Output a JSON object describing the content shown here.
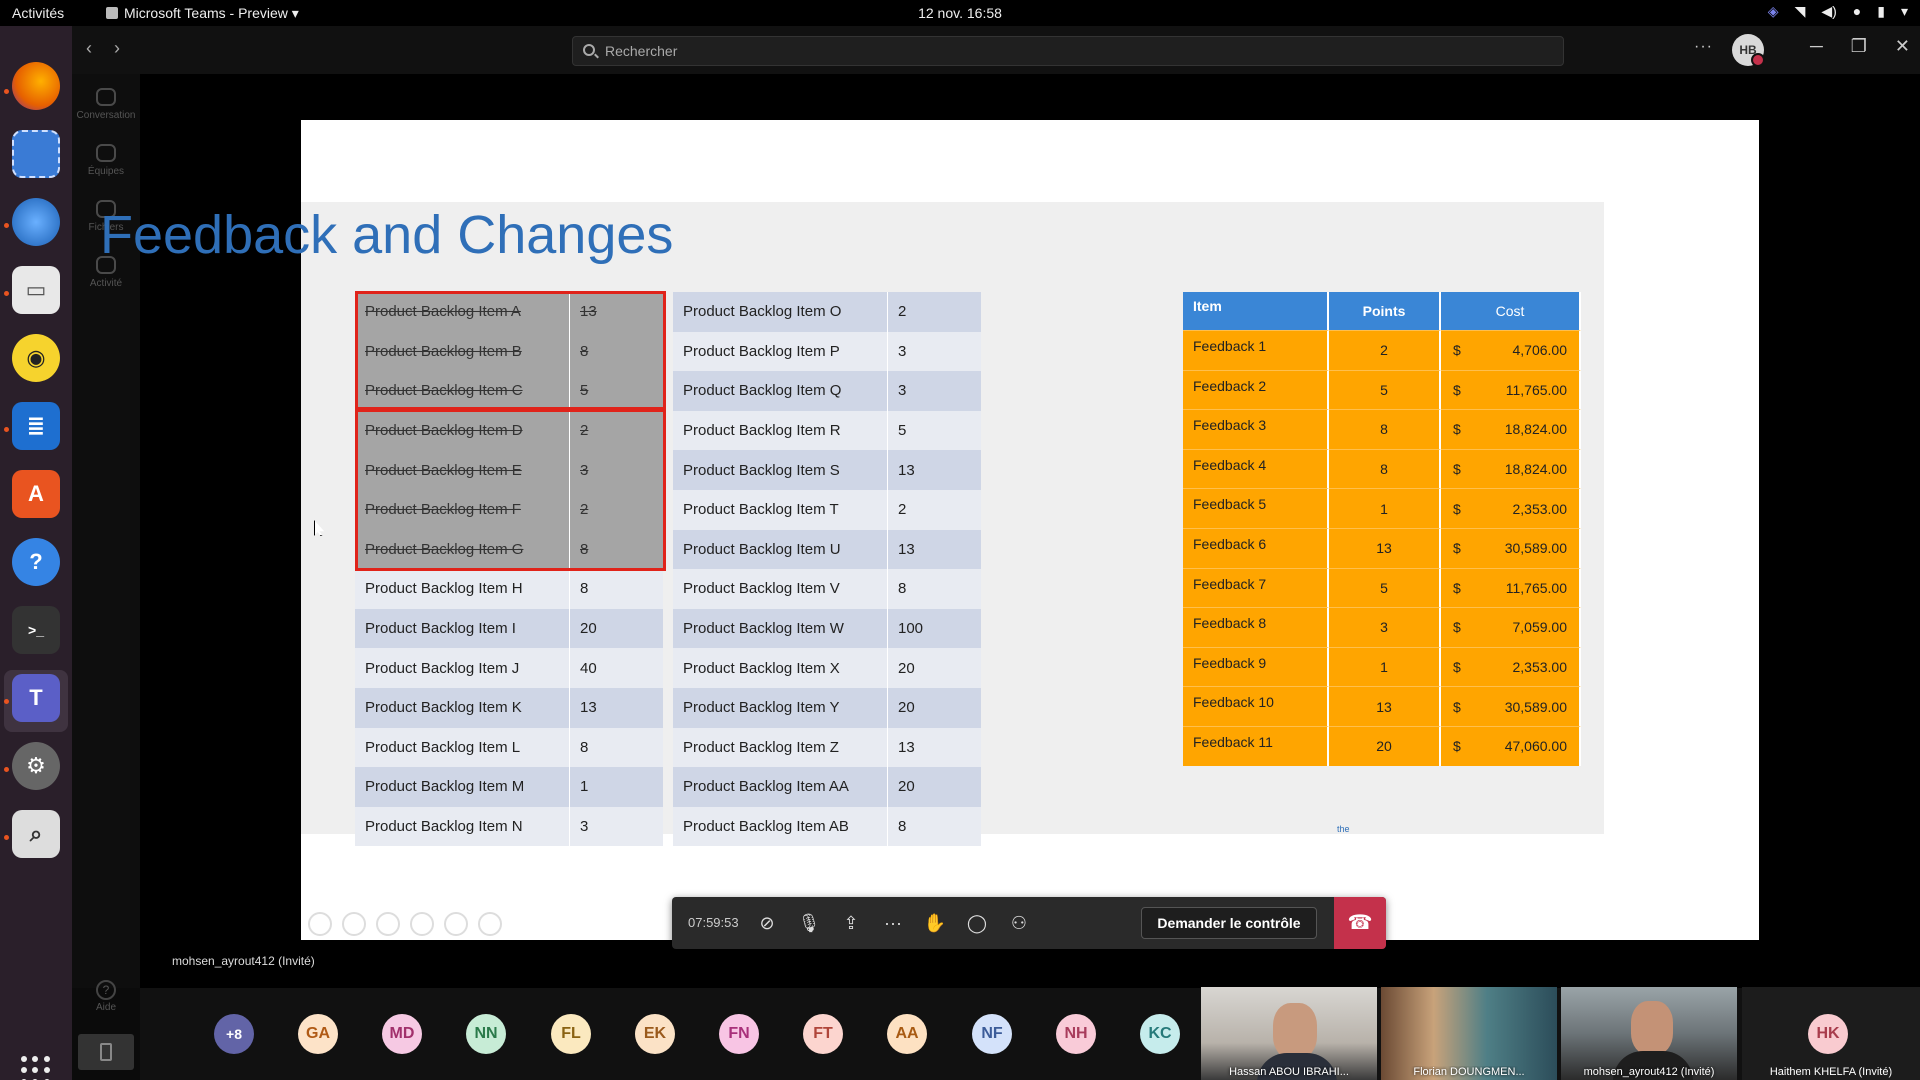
{
  "topbar": {
    "activities": "Activités",
    "app_name": "Microsoft Teams - Preview ▾",
    "clock": "12 nov.  16:58"
  },
  "teams": {
    "search_placeholder": "Rechercher",
    "avatar_initials": "HB",
    "rail": [
      {
        "label": "Conversation",
        "icon": "chat-icon"
      },
      {
        "label": "Équipes",
        "icon": "teams-icon"
      },
      {
        "label": "Fichiers",
        "icon": "files-icon"
      },
      {
        "label": "Activité",
        "icon": "bell-icon"
      }
    ],
    "help_label": "Aide"
  },
  "slide": {
    "title": "Feedback and Changes",
    "backlog_left": [
      {
        "name": "Product Backlog Item A",
        "points": "13",
        "done": true
      },
      {
        "name": "Product Backlog Item B",
        "points": "8",
        "done": true
      },
      {
        "name": "Product Backlog Item C",
        "points": "5",
        "done": true
      },
      {
        "name": "Product Backlog Item D",
        "points": "2",
        "done": true
      },
      {
        "name": "Product Backlog Item E",
        "points": "3",
        "done": true
      },
      {
        "name": "Product Backlog Item F",
        "points": "2",
        "done": true
      },
      {
        "name": "Product Backlog Item G",
        "points": "8",
        "done": true
      },
      {
        "name": "Product Backlog Item H",
        "points": "8",
        "done": false
      },
      {
        "name": "Product Backlog Item I",
        "points": "20",
        "done": false
      },
      {
        "name": "Product Backlog Item J",
        "points": "40",
        "done": false
      },
      {
        "name": "Product Backlog Item K",
        "points": "13",
        "done": false
      },
      {
        "name": "Product Backlog Item L",
        "points": "8",
        "done": false
      },
      {
        "name": "Product Backlog Item M",
        "points": "1",
        "done": false
      },
      {
        "name": "Product Backlog Item N",
        "points": "3",
        "done": false
      }
    ],
    "backlog_right": [
      {
        "name": "Product Backlog Item O",
        "points": "2"
      },
      {
        "name": "Product Backlog Item P",
        "points": "3"
      },
      {
        "name": "Product Backlog Item Q",
        "points": "3"
      },
      {
        "name": "Product Backlog Item R",
        "points": "5"
      },
      {
        "name": "Product Backlog Item S",
        "points": "13"
      },
      {
        "name": "Product Backlog Item T",
        "points": "2"
      },
      {
        "name": "Product Backlog Item U",
        "points": "13"
      },
      {
        "name": "Product Backlog Item V",
        "points": "8"
      },
      {
        "name": "Product Backlog Item W",
        "points": "100"
      },
      {
        "name": "Product Backlog Item X",
        "points": "20"
      },
      {
        "name": "Product Backlog Item Y",
        "points": "20"
      },
      {
        "name": "Product Backlog Item Z",
        "points": "13"
      },
      {
        "name": "Product Backlog Item AA",
        "points": "20"
      },
      {
        "name": "Product Backlog Item AB",
        "points": "8"
      }
    ],
    "cost_table": {
      "headers": [
        "Item",
        "Points",
        "Cost"
      ],
      "rows": [
        {
          "item": "Feedback 1",
          "points": "2",
          "currency": "$",
          "cost": "4,706.00"
        },
        {
          "item": "Feedback 2",
          "points": "5",
          "currency": "$",
          "cost": "11,765.00"
        },
        {
          "item": "Feedback 3",
          "points": "8",
          "currency": "$",
          "cost": "18,824.00"
        },
        {
          "item": "Feedback 4",
          "points": "8",
          "currency": "$",
          "cost": "18,824.00"
        },
        {
          "item": "Feedback 5",
          "points": "1",
          "currency": "$",
          "cost": "2,353.00"
        },
        {
          "item": "Feedback 6",
          "points": "13",
          "currency": "$",
          "cost": "30,589.00"
        },
        {
          "item": "Feedback 7",
          "points": "5",
          "currency": "$",
          "cost": "11,765.00"
        },
        {
          "item": "Feedback 8",
          "points": "3",
          "currency": "$",
          "cost": "7,059.00"
        },
        {
          "item": "Feedback 9",
          "points": "1",
          "currency": "$",
          "cost": "2,353.00"
        },
        {
          "item": "Feedback 10",
          "points": "13",
          "currency": "$",
          "cost": "30,589.00"
        },
        {
          "item": "Feedback 11",
          "points": "20",
          "currency": "$",
          "cost": "47,060.00"
        }
      ]
    },
    "tiny_text": "the"
  },
  "call": {
    "timer": "07:59:53",
    "request_control": "Demander le contrôle",
    "presenter_name": "mohsen_ayrout412 (Invité)"
  },
  "participants": {
    "overflow": "+8",
    "avatars": [
      {
        "initials": "GA",
        "bg": "#fde3c8",
        "fg": "#b05a15"
      },
      {
        "initials": "MD",
        "bg": "#f6c9e3",
        "fg": "#a1306b"
      },
      {
        "initials": "NN",
        "bg": "#c7ecd6",
        "fg": "#2a7a4a"
      },
      {
        "initials": "FL",
        "bg": "#fbe9bf",
        "fg": "#8a6212"
      },
      {
        "initials": "EK",
        "bg": "#fbe2c6",
        "fg": "#9a5a1c"
      },
      {
        "initials": "FN",
        "bg": "#f8c5e4",
        "fg": "#a8307a"
      },
      {
        "initials": "FT",
        "bg": "#fcd5cf",
        "fg": "#b0453a"
      },
      {
        "initials": "AA",
        "bg": "#fde1c2",
        "fg": "#a85a12"
      },
      {
        "initials": "NF",
        "bg": "#d4e2fa",
        "fg": "#3c5c99"
      },
      {
        "initials": "NH",
        "bg": "#f9cbd8",
        "fg": "#a83c5c"
      },
      {
        "initials": "KC",
        "bg": "#c6ecec",
        "fg": "#267a7a"
      }
    ],
    "video_tiles": [
      {
        "name": "Hassan ABOU IBRAHI..."
      },
      {
        "name": "Florian DOUNGMEN..."
      },
      {
        "name": "mohsen_ayrout412 (Invité)"
      }
    ],
    "last_tile": {
      "initials": "HK",
      "name": "Haithem KHELFA (Invité)"
    }
  }
}
